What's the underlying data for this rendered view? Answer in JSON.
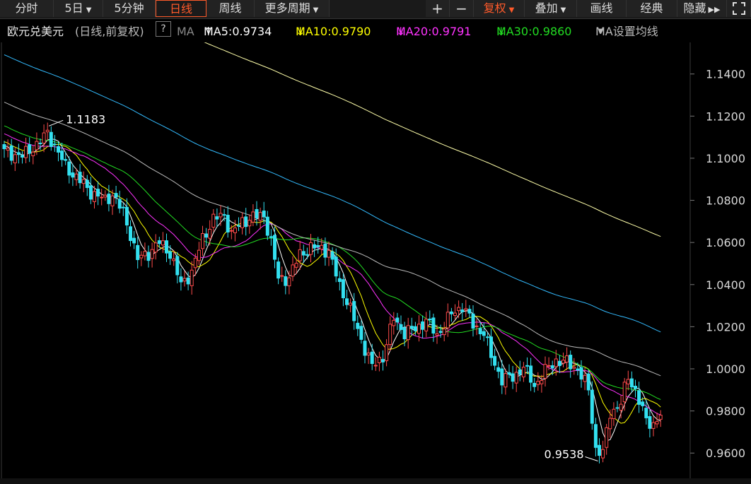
{
  "toolbar": {
    "left": [
      {
        "label": "分时",
        "active": false
      },
      {
        "label": "5日",
        "active": false,
        "caret": true
      },
      {
        "label": "5分钟",
        "active": false
      },
      {
        "label": "日线",
        "active": true
      },
      {
        "label": "周线",
        "active": false
      },
      {
        "label": "更多周期",
        "active": false,
        "caret": true
      }
    ],
    "right": [
      {
        "label": "+",
        "icon": "zoom-in-icon"
      },
      {
        "label": "−",
        "icon": "zoom-out-icon"
      },
      {
        "label": "复权",
        "caret": true,
        "selected": true
      },
      {
        "label": "叠加",
        "caret": true
      },
      {
        "label": "画线"
      },
      {
        "label": "经典"
      },
      {
        "label": "隐藏",
        "icon": "double-chevron-right-icon"
      },
      {
        "label": "",
        "icon": "fullscreen-icon"
      }
    ]
  },
  "legend": {
    "symbol": "欧元兑美元",
    "mode": "(日线,前复权)",
    "help": "?",
    "ma_label": "MA",
    "ma5": {
      "text": "MA5:0.9734",
      "arrow": "↑",
      "color": "#ffffff"
    },
    "ma10": {
      "text": "MA10:0.9790",
      "arrow": "↓",
      "color": "#ffff00"
    },
    "ma20": {
      "text": "MA20:0.9791",
      "arrow": "↓",
      "color": "#ff33ff"
    },
    "ma30": {
      "text": "MA30:0.9860",
      "arrow": "↓",
      "color": "#22dd22"
    },
    "settings": "MA设置均线"
  },
  "chart_data": {
    "type": "candlestick",
    "y_ticks": [
      "1.1400",
      "1.1200",
      "1.1000",
      "1.0800",
      "1.0600",
      "1.0400",
      "1.0200",
      "1.0000",
      "0.9800",
      "0.9600"
    ],
    "ylim": [
      0.948,
      1.155
    ],
    "annotations": {
      "high": "1.1183",
      "low": "0.9538"
    },
    "colors": {
      "up": "#ff4b4b",
      "down": "#33e0f0",
      "ma5": "#ffffff",
      "ma10": "#ffff00",
      "ma20": "#ff33ff",
      "ma30": "#22dd22",
      "ma60": "#bbbbbb",
      "ma120": "#33bbff",
      "ma250": "#ffffaa"
    },
    "close_anchors": [
      [
        0,
        1.103
      ],
      [
        5,
        1.101
      ],
      [
        10,
        1.108
      ],
      [
        12,
        1.112
      ],
      [
        14,
        1.106
      ],
      [
        17,
        1.096
      ],
      [
        20,
        1.091
      ],
      [
        24,
        1.084
      ],
      [
        28,
        1.08
      ],
      [
        30,
        1.083
      ],
      [
        33,
        1.074
      ],
      [
        35,
        1.064
      ],
      [
        37,
        1.052
      ],
      [
        40,
        1.055
      ],
      [
        43,
        1.06
      ],
      [
        46,
        1.055
      ],
      [
        49,
        1.04
      ],
      [
        52,
        1.046
      ],
      [
        55,
        1.062
      ],
      [
        58,
        1.071
      ],
      [
        61,
        1.073
      ],
      [
        63,
        1.064
      ],
      [
        66,
        1.07
      ],
      [
        69,
        1.072
      ],
      [
        72,
        1.073
      ],
      [
        74,
        1.06
      ],
      [
        76,
        1.043
      ],
      [
        79,
        1.043
      ],
      [
        82,
        1.055
      ],
      [
        85,
        1.057
      ],
      [
        88,
        1.058
      ],
      [
        90,
        1.055
      ],
      [
        93,
        1.04
      ],
      [
        96,
        1.028
      ],
      [
        99,
        1.014
      ],
      [
        102,
        1.001
      ],
      [
        105,
        1.006
      ],
      [
        108,
        1.024
      ],
      [
        111,
        1.017
      ],
      [
        114,
        1.019
      ],
      [
        117,
        1.023
      ],
      [
        120,
        1.016
      ],
      [
        124,
        1.026
      ],
      [
        127,
        1.03
      ],
      [
        130,
        1.021
      ],
      [
        133,
        1.017
      ],
      [
        135,
        1.006
      ],
      [
        138,
        0.995
      ],
      [
        141,
        0.996
      ],
      [
        144,
        1.001
      ],
      [
        147,
        0.992
      ],
      [
        150,
        0.999
      ],
      [
        153,
        1.004
      ],
      [
        156,
        1.003
      ],
      [
        159,
        1.0
      ],
      [
        162,
        0.99
      ],
      [
        164,
        0.962
      ],
      [
        166,
        0.96
      ],
      [
        168,
        0.979
      ],
      [
        171,
        0.984
      ],
      [
        173,
        0.996
      ],
      [
        175,
        0.99
      ],
      [
        178,
        0.975
      ],
      [
        180,
        0.974
      ],
      [
        182,
        0.978
      ]
    ]
  }
}
